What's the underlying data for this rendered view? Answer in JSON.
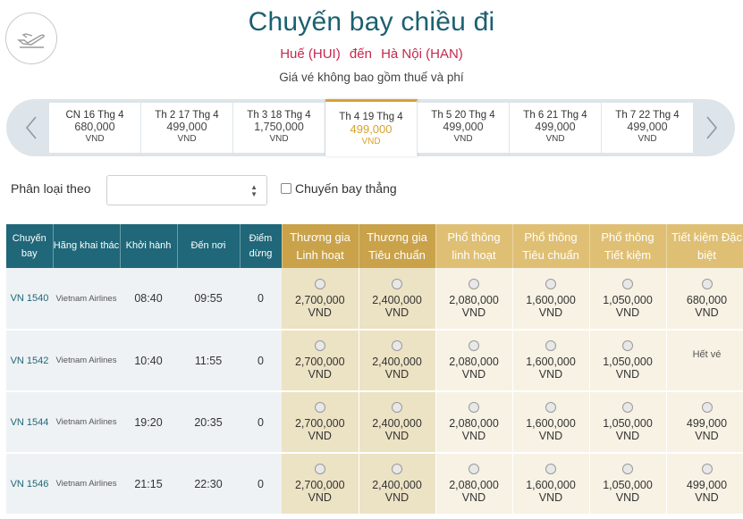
{
  "header": {
    "title": "Chuyến bay chiều đi",
    "origin": "Huế (HUI)",
    "connector": "đến",
    "destination": "Hà Nội (HAN)",
    "note": "Giá vé không bao gồm thuế và phí",
    "icon": "plane-departure-icon"
  },
  "date_bar": {
    "prev_icon": "chevron-left-icon",
    "next_icon": "chevron-right-icon",
    "dates": [
      {
        "label": "CN 16 Thg 4",
        "price": "680,000",
        "currency": "VND",
        "active": false
      },
      {
        "label": "Th 2 17 Thg 4",
        "price": "499,000",
        "currency": "VND",
        "active": false
      },
      {
        "label": "Th 3 18 Thg 4",
        "price": "1,750,000",
        "currency": "VND",
        "active": false
      },
      {
        "label": "Th 4 19 Thg 4",
        "price": "499,000",
        "currency": "VND",
        "active": true
      },
      {
        "label": "Th 5 20 Thg 4",
        "price": "499,000",
        "currency": "VND",
        "active": false
      },
      {
        "label": "Th 6 21 Thg 4",
        "price": "499,000",
        "currency": "VND",
        "active": false
      },
      {
        "label": "Th 7 22 Thg 4",
        "price": "499,000",
        "currency": "VND",
        "active": false
      }
    ],
    "accent_color": "#d6a32e"
  },
  "filters": {
    "sort_label": "Phân loại theo",
    "sort_value": "",
    "direct_label": "Chuyến bay thẳng",
    "direct_checked": false
  },
  "table": {
    "info_headers": [
      {
        "line1": "Chuyến",
        "line2": "bay"
      },
      {
        "line1": "Hãng khai thác",
        "line2": ""
      },
      {
        "line1": "Khởi hành",
        "line2": ""
      },
      {
        "line1": "Đến nơi",
        "line2": ""
      },
      {
        "line1": "Điểm",
        "line2": "dừng"
      }
    ],
    "fare_headers": [
      {
        "line1": "Thương gia",
        "line2": "Linh hoạt",
        "class": "bus"
      },
      {
        "line1": "Thương gia",
        "line2": "Tiêu chuẩn",
        "class": "bus"
      },
      {
        "line1": "Phổ thông",
        "line2": "linh hoạt",
        "class": "eco"
      },
      {
        "line1": "Phổ thông",
        "line2": "Tiêu chuẩn",
        "class": "eco"
      },
      {
        "line1": "Phổ thông",
        "line2": "Tiết kiệm",
        "class": "eco"
      },
      {
        "line1": "Tiết kiệm Đặc",
        "line2": "biệt",
        "class": "eco"
      }
    ],
    "currency": "VND",
    "sold_out_text": "Hết vé",
    "rows": [
      {
        "flight": "VN 1540",
        "airline": "Vietnam Airlines",
        "depart": "08:40",
        "arrive": "09:55",
        "stops": "0",
        "fares": [
          "2,700,000",
          "2,400,000",
          "2,080,000",
          "1,600,000",
          "1,050,000",
          "680,000"
        ]
      },
      {
        "flight": "VN 1542",
        "airline": "Vietnam Airlines",
        "depart": "10:40",
        "arrive": "11:55",
        "stops": "0",
        "fares": [
          "2,700,000",
          "2,400,000",
          "2,080,000",
          "1,600,000",
          "1,050,000",
          null
        ]
      },
      {
        "flight": "VN 1544",
        "airline": "Vietnam Airlines",
        "depart": "19:20",
        "arrive": "20:35",
        "stops": "0",
        "fares": [
          "2,700,000",
          "2,400,000",
          "2,080,000",
          "1,600,000",
          "1,050,000",
          "499,000"
        ]
      },
      {
        "flight": "VN 1546",
        "airline": "Vietnam Airlines",
        "depart": "21:15",
        "arrive": "22:30",
        "stops": "0",
        "fares": [
          "2,700,000",
          "2,400,000",
          "2,080,000",
          "1,600,000",
          "1,050,000",
          "499,000"
        ]
      }
    ]
  },
  "colors": {
    "title": "#1b6070",
    "route": "#c6284d",
    "header_info": "#1f6779",
    "header_business": "#c9a24a",
    "header_economy": "#dfbf73"
  }
}
